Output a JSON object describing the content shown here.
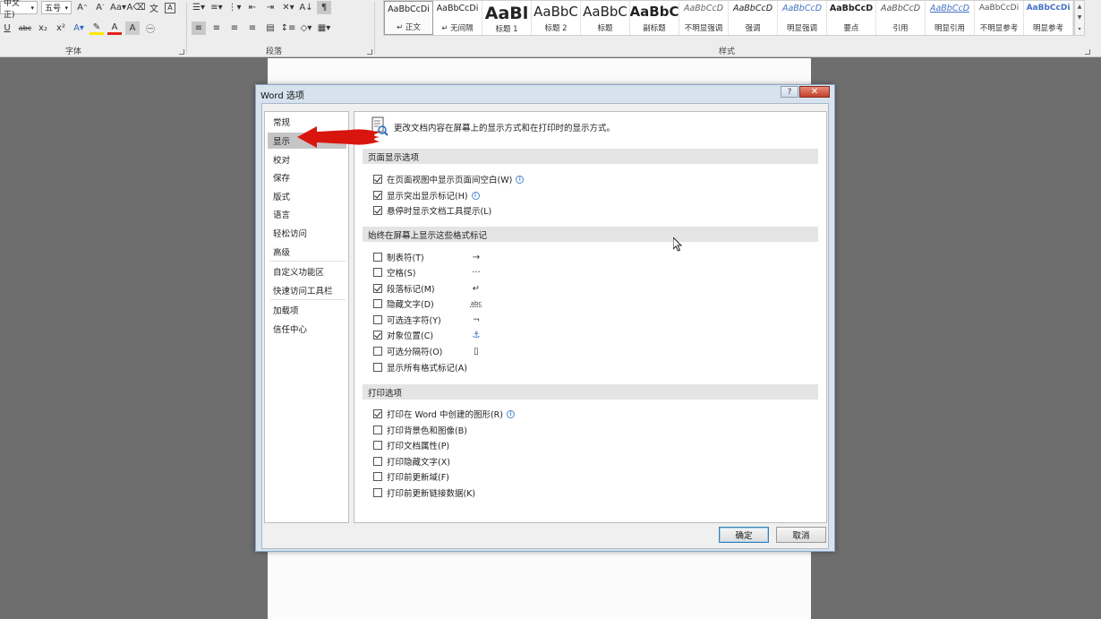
{
  "ribbon": {
    "font_name": "中文正)",
    "font_size": "五号",
    "groups": [
      {
        "label": "字体"
      },
      {
        "label": "段落"
      },
      {
        "label": "样式"
      }
    ],
    "styles": [
      {
        "sample": "AaBbCcDi",
        "name": "↵ 正文"
      },
      {
        "sample": "AaBbCcDi",
        "name": "↵ 无间隔"
      },
      {
        "sample": "AaBl",
        "name": "标题 1"
      },
      {
        "sample": "AaBbC",
        "name": "标题 2"
      },
      {
        "sample": "AaBbC",
        "name": "标题"
      },
      {
        "sample": "AaBbC",
        "name": "副标题"
      },
      {
        "sample": "AaBbCcD",
        "name": "不明显强调"
      },
      {
        "sample": "AaBbCcD",
        "name": "强调"
      },
      {
        "sample": "AaBbCcD",
        "name": "明显强调"
      },
      {
        "sample": "AaBbCcD",
        "name": "要点"
      },
      {
        "sample": "AaBbCcD",
        "name": "引用"
      },
      {
        "sample": "AaBbCcD",
        "name": "明显引用"
      },
      {
        "sample": "AaBbCcDi",
        "name": "不明显参考"
      },
      {
        "sample": "AaBbCcDi",
        "name": "明显参考"
      }
    ]
  },
  "dialog": {
    "title": "Word 选项",
    "help_label": "?",
    "close_label": "✕",
    "nav": [
      {
        "label": "常规"
      },
      {
        "label": "显示"
      },
      {
        "label": "校对"
      },
      {
        "label": "保存"
      },
      {
        "label": "版式"
      },
      {
        "label": "语言"
      },
      {
        "label": "轻松访问"
      },
      {
        "label": "高级"
      },
      {
        "label": "自定义功能区"
      },
      {
        "label": "快速访问工具栏"
      },
      {
        "label": "加载项"
      },
      {
        "label": "信任中心"
      }
    ],
    "selected_nav": "显示",
    "header_text": "更改文档内容在屏幕上的显示方式和在打印时的显示方式。",
    "sections": [
      {
        "title": "页面显示选项",
        "options": [
          {
            "label": "在页面视图中显示页面间空白(W)",
            "checked": true,
            "info": true
          },
          {
            "label": "显示突出显示标记(H)",
            "checked": true,
            "info": true
          },
          {
            "label": "悬停时显示文档工具提示(L)",
            "checked": true,
            "info": false
          }
        ]
      },
      {
        "title": "始终在屏幕上显示这些格式标记",
        "options": [
          {
            "label": "制表符(T)",
            "checked": false,
            "symbol": "→"
          },
          {
            "label": "空格(S)",
            "checked": false,
            "symbol": "···"
          },
          {
            "label": "段落标记(M)",
            "checked": true,
            "symbol": "↵"
          },
          {
            "label": "隐藏文字(D)",
            "checked": false,
            "symbol": "abc"
          },
          {
            "label": "可选连字符(Y)",
            "checked": false,
            "symbol": "¬"
          },
          {
            "label": "对象位置(C)",
            "checked": true,
            "symbol": "⚓"
          },
          {
            "label": "可选分隔符(O)",
            "checked": false,
            "symbol": "▯"
          },
          {
            "label": "显示所有格式标记(A)",
            "checked": false,
            "symbol": ""
          }
        ]
      },
      {
        "title": "打印选项",
        "options": [
          {
            "label": "打印在 Word 中创建的图形(R)",
            "checked": true,
            "info": true
          },
          {
            "label": "打印背景色和图像(B)",
            "checked": false,
            "info": false
          },
          {
            "label": "打印文档属性(P)",
            "checked": false,
            "info": false
          },
          {
            "label": "打印隐藏文字(X)",
            "checked": false,
            "info": false
          },
          {
            "label": "打印前更新域(F)",
            "checked": false,
            "info": false
          },
          {
            "label": "打印前更新链接数据(K)",
            "checked": false,
            "info": false
          }
        ]
      }
    ],
    "ok_label": "确定",
    "cancel_label": "取消"
  },
  "colors": {
    "arrow": "#d9150f",
    "nav_selected": "#c5c5c5",
    "close_button": "#c4402a"
  }
}
